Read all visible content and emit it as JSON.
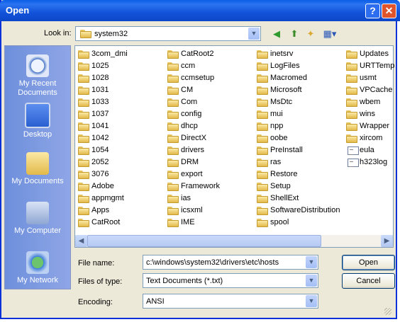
{
  "window": {
    "title": "Open"
  },
  "toolbar": {
    "look_in_label": "Look in:",
    "look_in_value": "system32"
  },
  "places": [
    {
      "label": "My Recent Documents",
      "icon": "recent-documents-icon"
    },
    {
      "label": "Desktop",
      "icon": "desktop-icon"
    },
    {
      "label": "My Documents",
      "icon": "my-documents-icon"
    },
    {
      "label": "My Computer",
      "icon": "my-computer-icon"
    },
    {
      "label": "My Network",
      "icon": "my-network-icon"
    }
  ],
  "files": {
    "col1": [
      "3com_dmi",
      "1025",
      "1028",
      "1031",
      "1033",
      "1037",
      "1041",
      "1042",
      "1054",
      "2052",
      "3076",
      "Adobe",
      "appmgmt",
      "Apps",
      "CatRoot"
    ],
    "col2": [
      "CatRoot2",
      "ccm",
      "ccmsetup",
      "CM",
      "Com",
      "config",
      "dhcp",
      "DirectX",
      "drivers",
      "DRM",
      "export",
      "Framework",
      "ias",
      "icsxml",
      "IME"
    ],
    "col3": [
      "inetsrv",
      "LogFiles",
      "Macromed",
      "Microsoft",
      "MsDtc",
      "mui",
      "npp",
      "oobe",
      "PreInstall",
      "ras",
      "Restore",
      "Setup",
      "ShellExt",
      "SoftwareDistribution",
      "spool"
    ],
    "col4": [
      "Updates",
      "URTTemp",
      "usmt",
      "VPCache",
      "wbem",
      "wins",
      "Wrapper",
      "xircom",
      "eula",
      "h323log"
    ]
  },
  "form": {
    "file_name_label": "File name:",
    "file_name_value": "c:\\windows\\system32\\drivers\\etc\\hosts",
    "files_of_type_label": "Files of type:",
    "files_of_type_value": "Text Documents (*.txt)",
    "encoding_label": "Encoding:",
    "encoding_value": "ANSI"
  },
  "buttons": {
    "open": "Open",
    "cancel": "Cancel"
  },
  "colors": {
    "title_bar": "#0a5ee6",
    "places_bar": "#7a96df",
    "folder": "#e8c45f"
  }
}
